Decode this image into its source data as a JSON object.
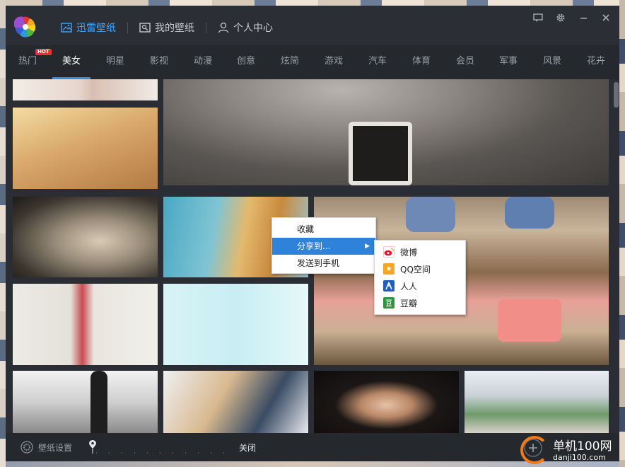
{
  "app": {
    "nav": [
      {
        "label": "迅雷壁纸",
        "icon": "image-icon",
        "active": true
      },
      {
        "label": "我的壁纸",
        "icon": "my-wallpaper-icon",
        "active": false
      },
      {
        "label": "个人中心",
        "icon": "user-icon",
        "active": false
      }
    ],
    "window_controls": [
      "feedback-icon",
      "settings-gear-icon",
      "minimize-icon",
      "close-icon"
    ],
    "accent_color": "#3fa6ff"
  },
  "tabs": [
    {
      "label": "热门",
      "badge": "HOT"
    },
    {
      "label": "美女",
      "active": true
    },
    {
      "label": "明星"
    },
    {
      "label": "影视"
    },
    {
      "label": "动漫"
    },
    {
      "label": "创意"
    },
    {
      "label": "炫简"
    },
    {
      "label": "游戏"
    },
    {
      "label": "汽车"
    },
    {
      "label": "体育"
    },
    {
      "label": "会员"
    },
    {
      "label": "军事"
    },
    {
      "label": "风景"
    },
    {
      "label": "花卉"
    }
  ],
  "context_menu": {
    "items": [
      {
        "label": "收藏"
      },
      {
        "label": "分享到...",
        "highlighted": true,
        "submenu": true
      },
      {
        "label": "发送到手机"
      }
    ],
    "submenu": [
      {
        "label": "微博",
        "icon": "weibo-icon",
        "color": "#e6162d"
      },
      {
        "label": "QQ空间",
        "icon": "qzone-icon",
        "color": "#f5a623"
      },
      {
        "label": "人人",
        "icon": "renren-icon",
        "color": "#1e5fbf"
      },
      {
        "label": "豆瓣",
        "icon": "douban-icon",
        "color": "#2e963d"
      }
    ]
  },
  "footer": {
    "settings_label": "壁纸设置",
    "close_label": "关闭"
  },
  "watermark": {
    "title": "单机100网",
    "url": "danji100.com"
  }
}
